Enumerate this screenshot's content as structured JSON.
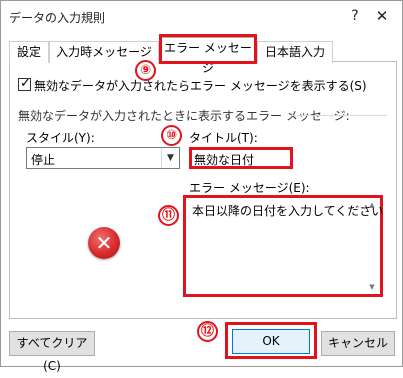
{
  "window": {
    "title": "データの入力規則",
    "help_label": "?",
    "close_label": "✕"
  },
  "tabs": [
    {
      "label": "設定",
      "active": false
    },
    {
      "label": "入力時メッセージ",
      "active": false
    },
    {
      "label": "エラー メッセージ",
      "active": true
    },
    {
      "label": "日本語入力",
      "active": false
    }
  ],
  "show_error": {
    "checked": true,
    "checkmark": "✓",
    "label": "無効なデータが入力されたらエラー メッセージを表示する(S)"
  },
  "group": {
    "label": "無効なデータが入力されたときに表示するエラー メッセージ:"
  },
  "style": {
    "label": "スタイル(Y):",
    "value": "停止",
    "dropdown_glyph": "▼",
    "icon_glyph": "✕"
  },
  "title_field": {
    "label": "タイトル(T):",
    "value": "無効な日付"
  },
  "message_field": {
    "label": "エラー メッセージ(E):",
    "value": "本日以降の日付を入力してください",
    "scroll_up": "▲",
    "scroll_down": "▼"
  },
  "markers": {
    "m9": "⑨",
    "m10": "⑩",
    "m11": "⑪",
    "m12": "⑫"
  },
  "buttons": {
    "clear_all": "すべてクリア(C)",
    "ok": "OK",
    "cancel": "キャンセル"
  },
  "colors": {
    "highlight": "#e3131b",
    "ok_border": "#0078d7",
    "error_icon": "#d92b2b"
  }
}
